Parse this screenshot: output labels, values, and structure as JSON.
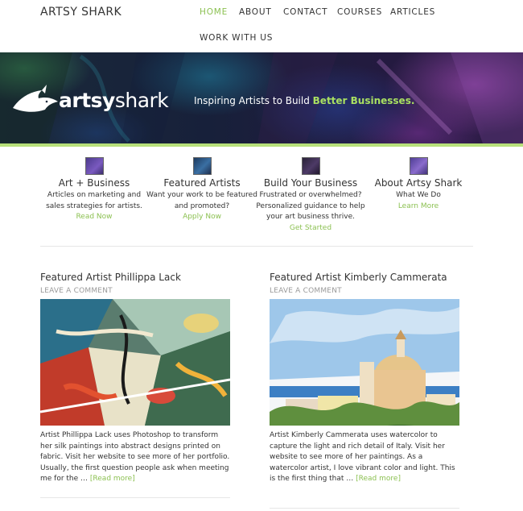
{
  "header": {
    "site_title": "ARTSY SHARK",
    "nav": [
      {
        "label": "HOME",
        "active": true
      },
      {
        "label": "ABOUT",
        "active": false
      },
      {
        "label": "CONTACT",
        "active": false
      },
      {
        "label": "COURSES",
        "active": false
      },
      {
        "label": "ARTICLES",
        "active": false
      },
      {
        "label": "WORK WITH US",
        "active": false
      }
    ],
    "accent_color": "#8cc152"
  },
  "banner": {
    "logo_bold": "artsy",
    "logo_light": "shark",
    "tagline_prefix": "Inspiring Artists to Build ",
    "tagline_highlight": "Better Businesses.",
    "highlight_color": "#a9e061"
  },
  "features": [
    {
      "title": "Art + Business",
      "description": "Articles on marketing and sales strategies for artists.",
      "link": "Read Now",
      "icon": "purple-swatch-icon",
      "swatch_color": "#6a4aa8"
    },
    {
      "title": "Featured Artists",
      "description": "Want your work to be featured and promoted?",
      "link": "Apply Now",
      "icon": "blue-swatch-icon",
      "swatch_color": "#2f5c8f"
    },
    {
      "title": "Build Your Business",
      "description": "Frustrated or overwhelmed? Personalized guidance to help your art business thrive.",
      "link": "Get Started",
      "icon": "dark-swatch-icon",
      "swatch_color": "#3a2f4f"
    },
    {
      "title": "About Artsy Shark",
      "description": "What We Do",
      "link": "Learn More",
      "icon": "violet-swatch-icon",
      "swatch_color": "#6b57b0"
    }
  ],
  "posts": [
    {
      "title": "Featured Artist Phillippa Lack",
      "meta": "LEAVE A COMMENT",
      "image_icon": "abstract-painting-image",
      "excerpt": "Artist Phillippa Lack uses Photoshop to transform her silk paintings into abstract designs printed on fabric. Visit her website to see more of her portfolio.    Usually, the first question people ask when meeting me for the … ",
      "read_more": "[Read more]"
    },
    {
      "title": "Featured Artist Kimberly Cammerata",
      "meta": "LEAVE A COMMENT",
      "image_icon": "watercolor-church-image",
      "excerpt": "Artist Kimberly Cammerata uses watercolor to capture the light and rich detail of Italy. Visit her website to see more of her paintings.    As a watercolor artist, I love vibrant color and light. This is the first thing that … ",
      "read_more": "[Read more]"
    }
  ]
}
